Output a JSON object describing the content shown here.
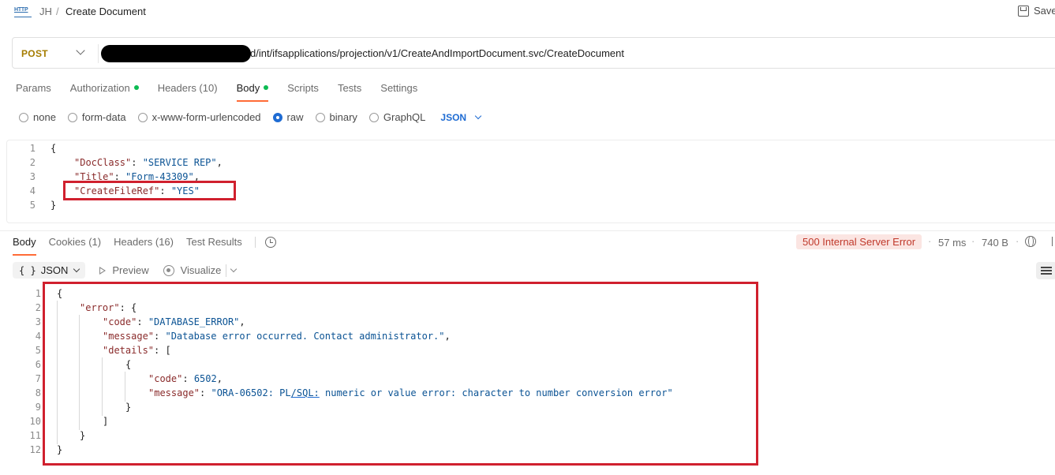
{
  "breadcrumb": {
    "icon": "http-icon",
    "icon_text": "HTTP",
    "workspace": "JH",
    "separator": "/",
    "title": "Create Document"
  },
  "toolbar": {
    "save_label": "Save"
  },
  "request": {
    "method": "POST",
    "url_visible": "d/int/ifsapplications/projection/v1/CreateAndImportDocument.svc/CreateDocument",
    "tabs": [
      {
        "label": "Params",
        "dot": false
      },
      {
        "label": "Authorization",
        "dot": true
      },
      {
        "label": "Headers (10)",
        "dot": false
      },
      {
        "label": "Body",
        "dot": true,
        "active": true
      },
      {
        "label": "Scripts",
        "dot": false
      },
      {
        "label": "Tests",
        "dot": false
      },
      {
        "label": "Settings",
        "dot": false
      }
    ],
    "body_types": [
      {
        "label": "none",
        "checked": false
      },
      {
        "label": "form-data",
        "checked": false
      },
      {
        "label": "x-www-form-urlencoded",
        "checked": false
      },
      {
        "label": "raw",
        "checked": true
      },
      {
        "label": "binary",
        "checked": false
      },
      {
        "label": "GraphQL",
        "checked": false
      }
    ],
    "format": "JSON",
    "body_lines": [
      {
        "n": "1",
        "open": "{"
      },
      {
        "n": "2",
        "key": "\"DocClass\"",
        "val": "\"SERVICE REP\"",
        "tail": ","
      },
      {
        "n": "3",
        "key": "\"Title\"",
        "val": "\"Form-43309\"",
        "tail": ","
      },
      {
        "n": "4",
        "key": "\"CreateFileRef\"",
        "val": "\"YES\"",
        "tail": ""
      },
      {
        "n": "5",
        "open": "}"
      }
    ]
  },
  "response": {
    "tabs": [
      {
        "label": "Body",
        "active": true
      },
      {
        "label": "Cookies (1)"
      },
      {
        "label": "Headers (16)"
      },
      {
        "label": "Test Results"
      }
    ],
    "status": "500 Internal Server Error",
    "time": "57 ms",
    "size": "740 B",
    "format": "JSON",
    "preview_label": "Preview",
    "visualize_label": "Visualize",
    "line_numbers": [
      "1",
      "2",
      "3",
      "4",
      "5",
      "6",
      "7",
      "8",
      "9",
      "10",
      "11",
      "12"
    ],
    "json": {
      "open": "{",
      "error_key": "\"error\"",
      "code_key": "\"code\"",
      "code_val": "\"DATABASE_ERROR\"",
      "message_key": "\"message\"",
      "message_val": "\"Database error occurred. Contact administrator.\"",
      "details_key": "\"details\"",
      "detail_code_key": "\"code\"",
      "detail_code_val": "6502",
      "detail_message_key": "\"message\"",
      "detail_message_val_a": "\"ORA-06502: PL",
      "detail_message_val_b": "/SQL:",
      "detail_message_val_c": " numeric or value error: character to number conversion error\"",
      "close": "}"
    }
  },
  "colors": {
    "accent_tab": "#ff6c37",
    "highlight_box": "#d0202e",
    "method": "#a57c00",
    "status_error_bg": "#fbe5e2",
    "status_error_fg": "#c0392b",
    "json_key": "#8a2b2b",
    "json_value": "#0b5394"
  }
}
